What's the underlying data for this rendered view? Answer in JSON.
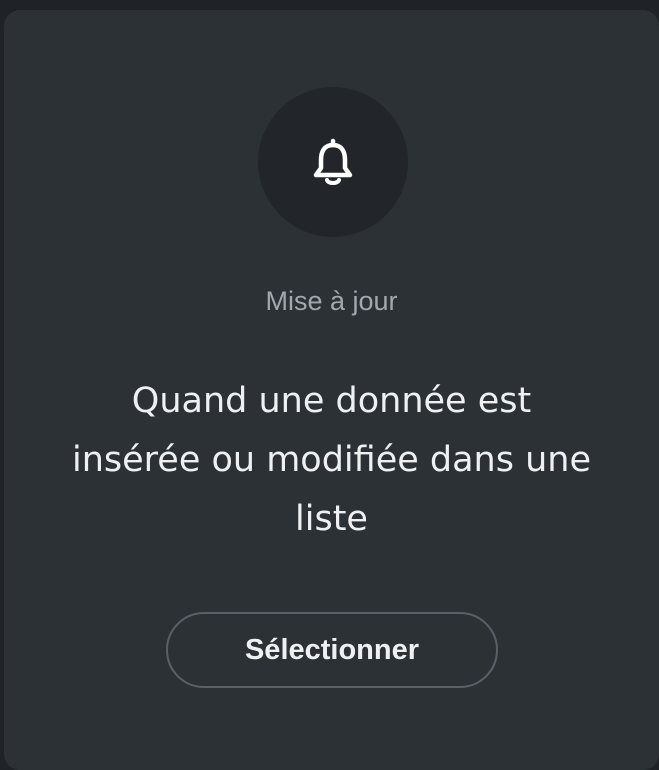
{
  "card": {
    "icon": "bell-icon",
    "category": "Mise à jour",
    "description": "Quand une donnée est insérée ou modifiée dans une liste",
    "button_label": "Sélectionner"
  },
  "colors": {
    "background": "#1f2226",
    "card": "#2c3136",
    "icon_circle": "#22262a",
    "text": "#eef0f2",
    "muted_text": "#a3a8ae",
    "button_border": "#5a6068"
  }
}
